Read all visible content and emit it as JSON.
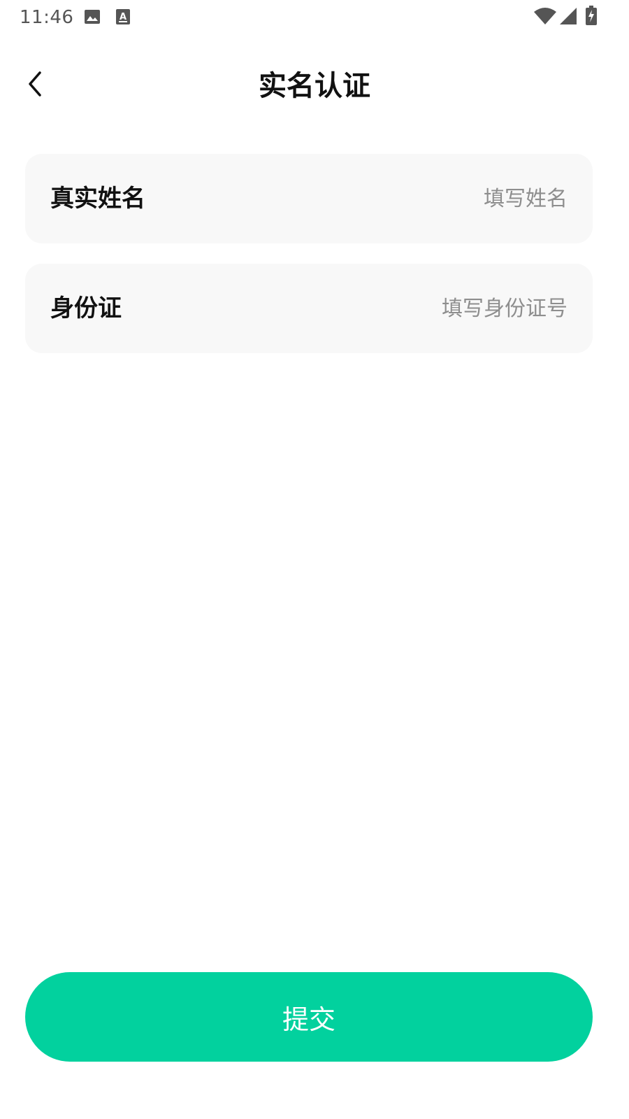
{
  "status_bar": {
    "time": "11:46",
    "left_icons": [
      "image-icon",
      "font-icon"
    ],
    "right_icons": [
      "wifi-icon",
      "signal-icon",
      "battery-charging-icon"
    ]
  },
  "header": {
    "title": "实名认证",
    "back_icon": "chevron-left-icon"
  },
  "form": {
    "name_field": {
      "label": "真实姓名",
      "value": "",
      "placeholder": "填写姓名"
    },
    "id_field": {
      "label": "身份证",
      "value": "",
      "placeholder": "填写身份证号"
    }
  },
  "submit": {
    "label": "提交"
  },
  "colors": {
    "accent": "#02d19e",
    "field_background": "#f8f8f8",
    "placeholder": "#8e8e8e",
    "status_text": "#555555"
  }
}
